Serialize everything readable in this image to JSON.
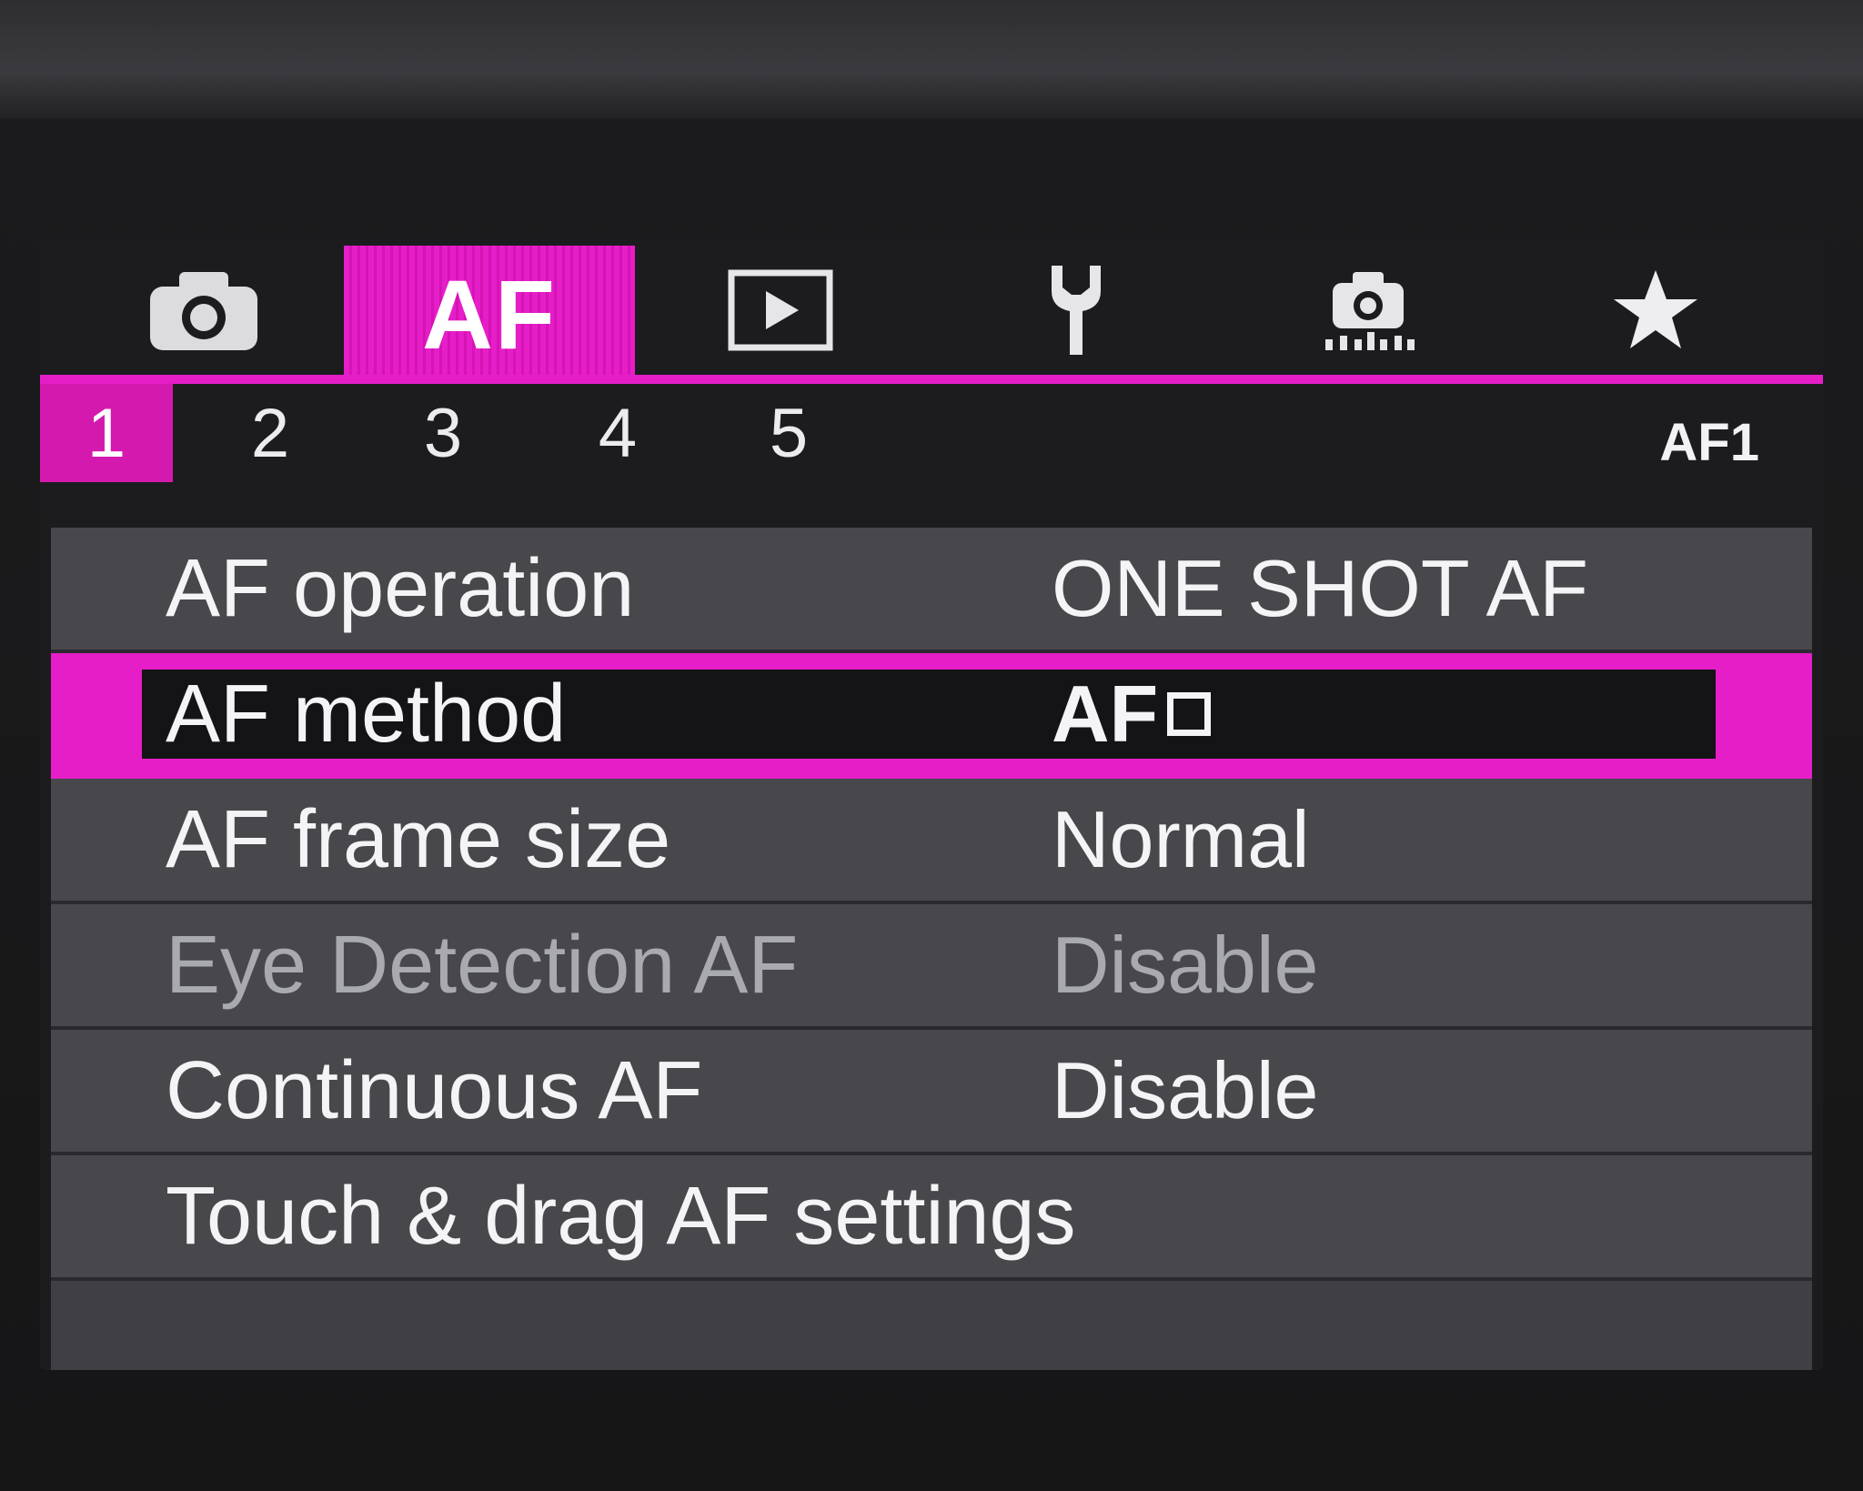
{
  "tabs": [
    {
      "icon": "camera-icon",
      "label": ""
    },
    {
      "icon": "af-tab",
      "label": "AF"
    },
    {
      "icon": "play-icon",
      "label": ""
    },
    {
      "icon": "wrench-icon",
      "label": ""
    },
    {
      "icon": "custom-camera-icon",
      "label": ""
    },
    {
      "icon": "star-icon",
      "label": ""
    }
  ],
  "active_tab": "AF",
  "subtabs": [
    "1",
    "2",
    "3",
    "4",
    "5"
  ],
  "active_subtab": "1",
  "page_code": "AF1",
  "menu": [
    {
      "label": "AF operation",
      "value": "ONE SHOT AF",
      "state": "normal"
    },
    {
      "label": "AF method",
      "value": "AF",
      "state": "selected"
    },
    {
      "label": "AF frame size",
      "value": "Normal",
      "state": "normal"
    },
    {
      "label": "Eye Detection AF",
      "value": "Disable",
      "state": "disabled"
    },
    {
      "label": "Continuous AF",
      "value": "Disable",
      "state": "normal"
    },
    {
      "label": "Touch & drag AF settings",
      "value": "",
      "state": "normal"
    }
  ],
  "colors": {
    "accent": "#e61ec8",
    "row_bg": "#47474c",
    "selected_inner": "#141416",
    "text": "#f4f4f6",
    "disabled_text": "#a9a9b0"
  }
}
